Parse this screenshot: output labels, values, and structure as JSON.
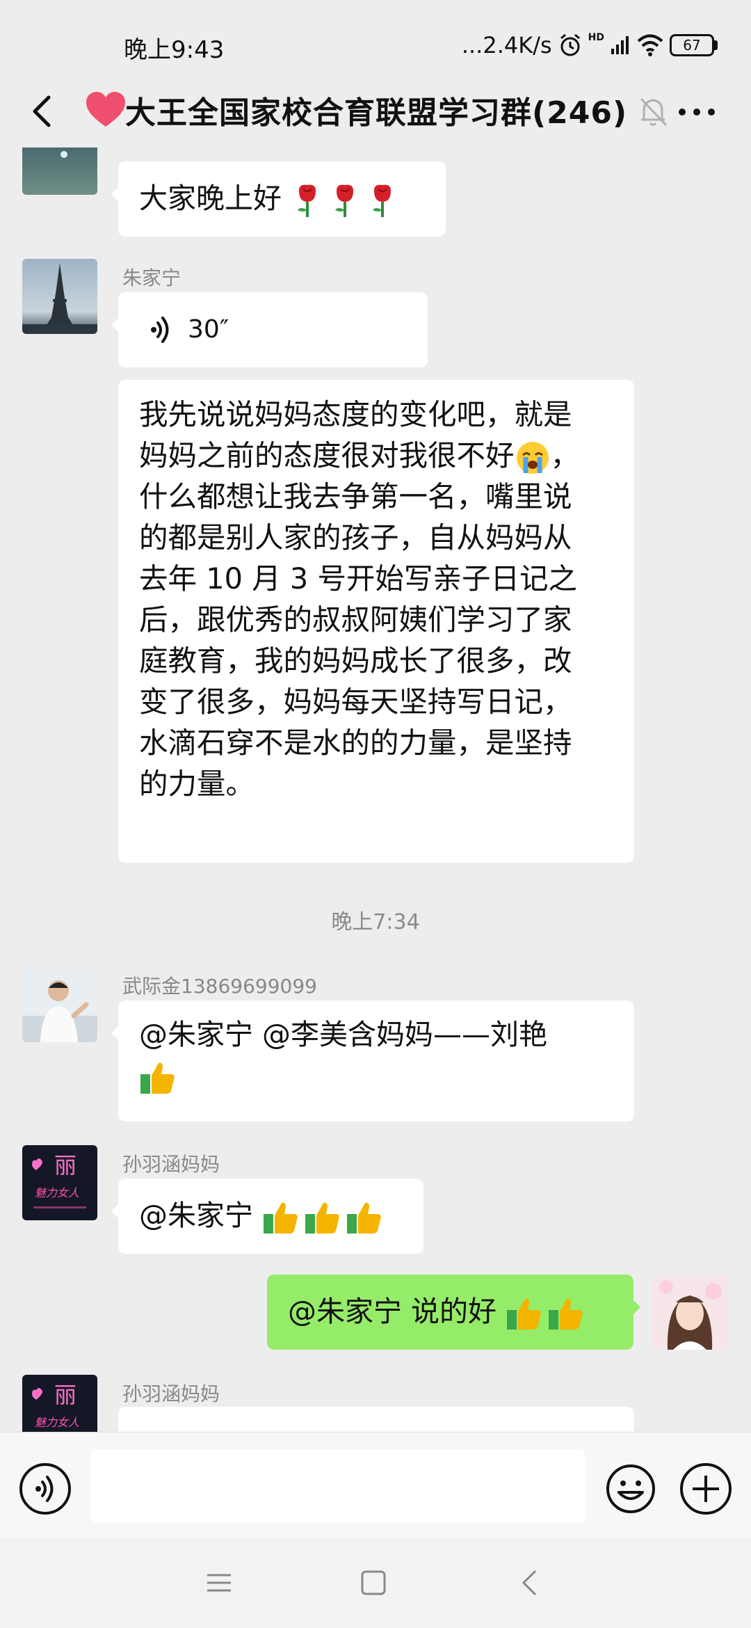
{
  "status_bar": {
    "time": "晚上9:43",
    "network_speed": "...2.4K/s",
    "hd_label": "HD",
    "battery": "67"
  },
  "header": {
    "title": "大王全国家校合育联盟学习群(246)"
  },
  "messages": {
    "m1": {
      "text": "大家晚上好"
    },
    "m2": {
      "sender": "朱家宁",
      "voice_duration": "30″"
    },
    "m3": {
      "lines": [
        "我先说说妈妈态度的变化吧，就是",
        "妈妈之前的态度很对我很不好",
        "什么都想让我去争第一名，嘴里说",
        "的都是别人家的孩子，自从妈妈从",
        "去年 10 月 3 号开始写亲子日记之",
        "后，跟优秀的叔叔阿姨们学习了家",
        "庭教育，我的妈妈成长了很多，改",
        "变了很多，妈妈每天坚持写日记，",
        "水滴石穿不是水的的力量，是坚持",
        "的力量。"
      ],
      "line2_suffix": "，"
    },
    "time_separator": "晚上7:34",
    "m4": {
      "sender": "武际金13869699099",
      "text": "@朱家宁  @李美含妈妈——刘艳"
    },
    "m5": {
      "sender": "孙羽涵妈妈",
      "text": "@朱家宁 "
    },
    "m6": {
      "text": "@朱家宁  说的好"
    },
    "m7": {
      "sender": "孙羽涵妈妈"
    }
  },
  "avatar_text": {
    "char": "丽",
    "script": "魅力女人"
  },
  "input": {
    "value": "",
    "placeholder": ""
  },
  "colors": {
    "self_bubble": "#95ec69",
    "other_bubble": "#ffffff",
    "background": "#ededed"
  }
}
